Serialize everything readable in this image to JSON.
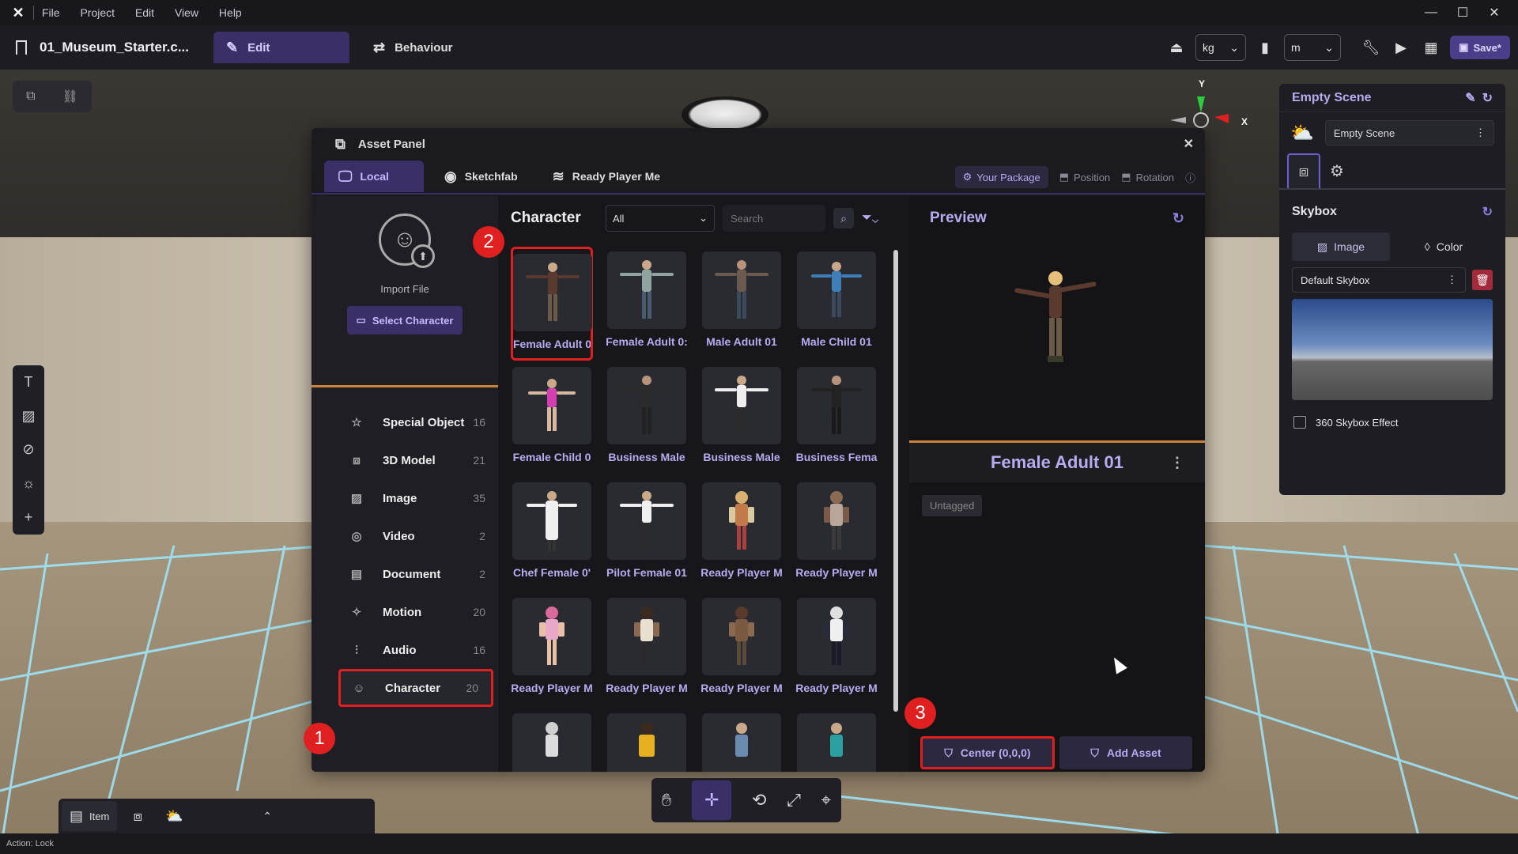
{
  "menu": {
    "items": [
      "File",
      "Project",
      "Edit",
      "View",
      "Help"
    ]
  },
  "window_controls": {
    "minimize": "—",
    "maximize": "☐",
    "close": "✕"
  },
  "toolbar": {
    "project_name": "01_Museum_Starter.c...",
    "edit_label": "Edit",
    "behaviour_label": "Behaviour",
    "mass_unit": "kg",
    "length_unit": "m",
    "save_label": "Save*"
  },
  "axis": {
    "y": "Y",
    "x": "X"
  },
  "inspector": {
    "title": "Empty Scene",
    "scene_value": "Empty Scene",
    "skybox_title": "Skybox",
    "image_label": "Image",
    "color_label": "Color",
    "skybox_value": "Default Skybox",
    "skybox_360_label": "360 Skybox Effect"
  },
  "asset_panel": {
    "title": "Asset Panel",
    "tabs": [
      {
        "label": "Local"
      },
      {
        "label": "Sketchfab"
      },
      {
        "label": "Ready Player Me"
      }
    ],
    "options": {
      "your_package": "Your Package",
      "position": "Position",
      "rotation": "Rotation"
    },
    "import_label": "Import File",
    "select_character": "Select Character",
    "categories": [
      {
        "name": "Special Object",
        "count": "16"
      },
      {
        "name": "3D Model",
        "count": "21"
      },
      {
        "name": "Image",
        "count": "35"
      },
      {
        "name": "Video",
        "count": "2"
      },
      {
        "name": "Document",
        "count": "2"
      },
      {
        "name": "Motion",
        "count": "20"
      },
      {
        "name": "Audio",
        "count": "16"
      },
      {
        "name": "Character",
        "count": "20"
      }
    ],
    "grid_title": "Character",
    "filter_value": "All",
    "search_placeholder": "Search",
    "assets": [
      "Female Adult 01",
      "Female Adult 0:",
      "Male Adult 01",
      "Male Child 01",
      "Female Child 0",
      "Business Male",
      "Business Male",
      "Business Fema",
      "Chef Female 0'",
      "Pilot Female 01",
      "Ready Player M",
      "Ready Player M",
      "Ready Player M",
      "Ready Player M",
      "Ready Player M",
      "Ready Player M"
    ],
    "preview": {
      "title": "Preview",
      "name": "Female Adult 01",
      "tag": "Untagged",
      "center_label": "Center (0,0,0)",
      "add_label": "Add Asset"
    }
  },
  "badges": [
    "1",
    "2",
    "3"
  ],
  "dock": {
    "item_label": "Item"
  },
  "status": {
    "text": "Action: Lock"
  },
  "colors": {
    "accent": "#3a2f66",
    "accent_text": "#b8acf0",
    "highlight": "#e02020",
    "divider": "#c8853a"
  }
}
